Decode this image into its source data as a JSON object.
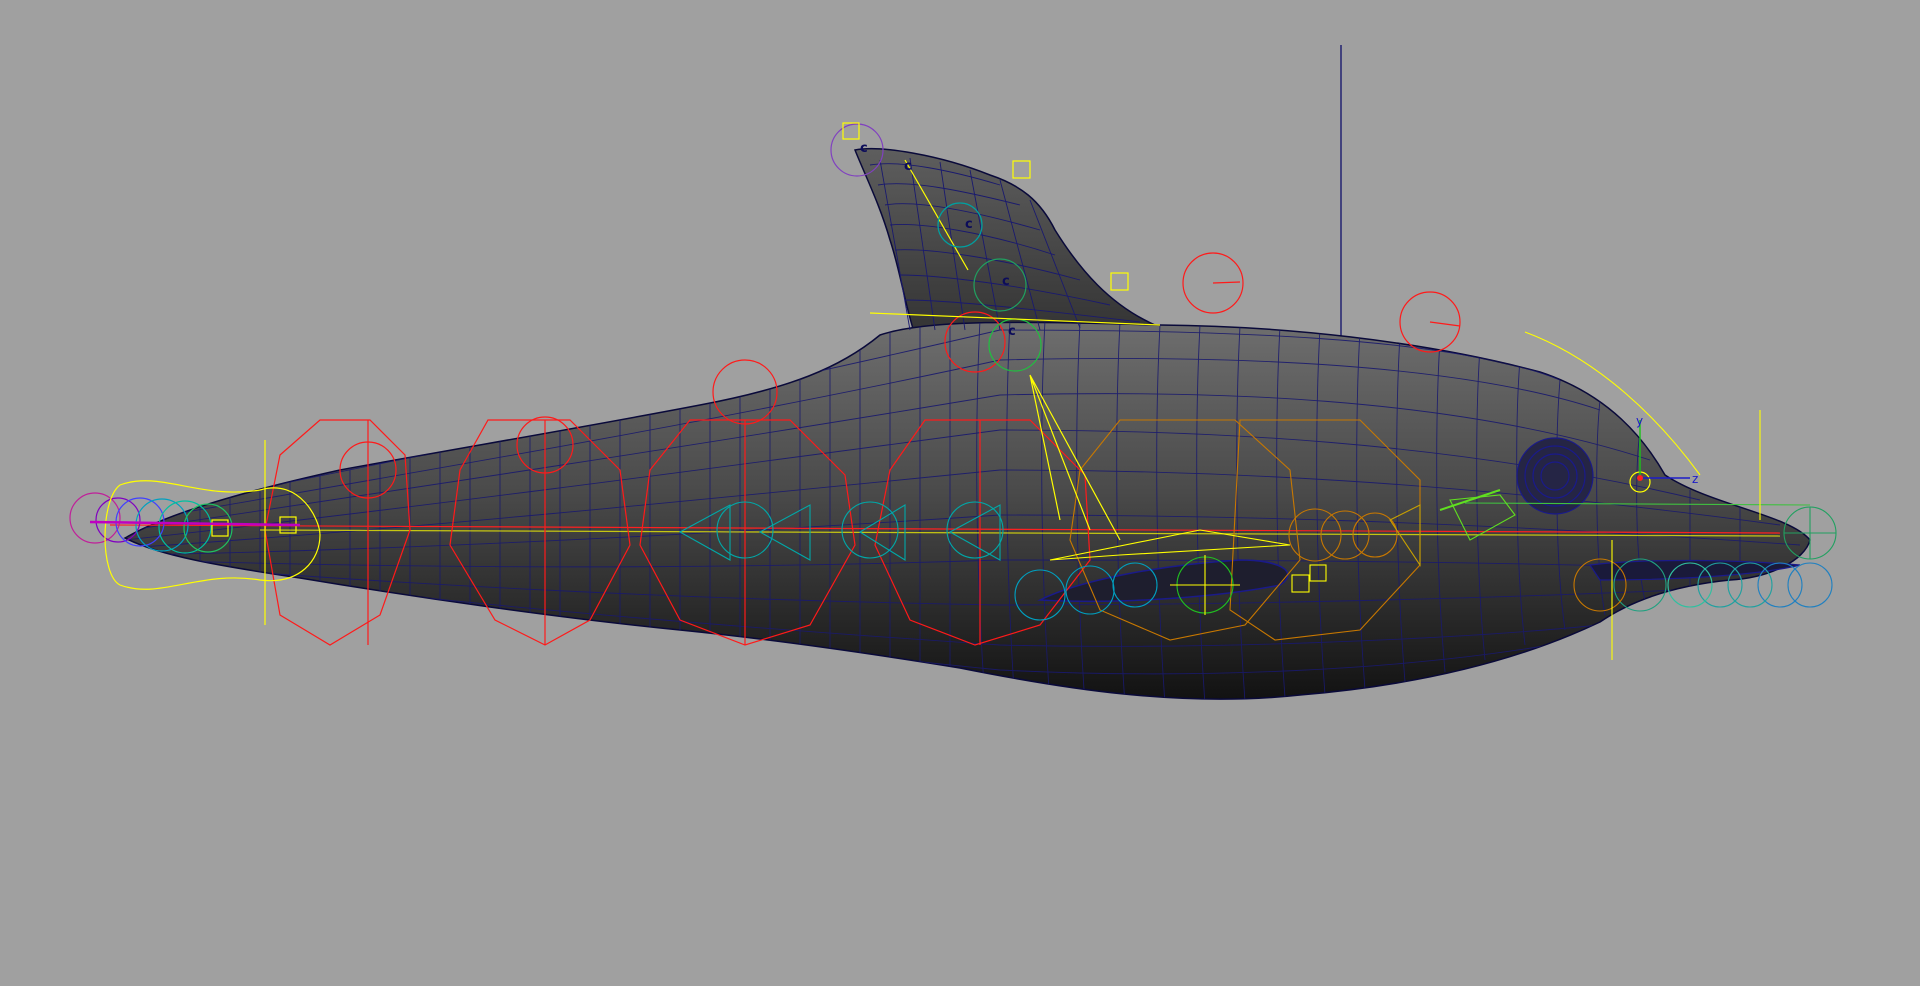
{
  "viewport": {
    "background": "#a0a0a0",
    "mesh_color": "#1a1a6e",
    "body_shade_light": "#6c6c6c",
    "body_shade_dark": "#141414"
  },
  "dorsal_fin_controls": {
    "labels": [
      "c",
      "c",
      "c",
      "c",
      "c"
    ]
  },
  "view_axis": {
    "y_label": "y",
    "z_label": "z",
    "y_color": "#19c419",
    "z_color": "#1c1cc8"
  },
  "control_colors": {
    "ik": "#ff0000",
    "fk": "#ffff00",
    "spine": "#00a0a0",
    "head": "#c87800",
    "tail": "#8000c0",
    "fin": "#00c060"
  }
}
